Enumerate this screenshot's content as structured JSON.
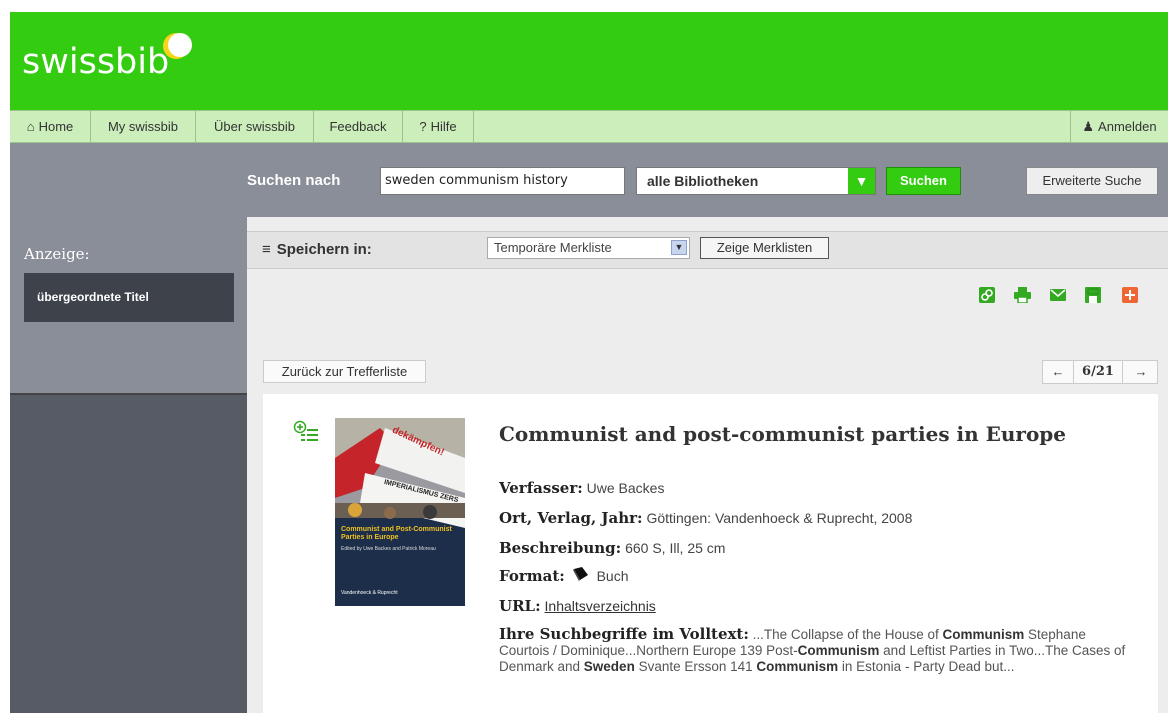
{
  "header": {
    "logo_text": "swissbib"
  },
  "nav": {
    "items": [
      {
        "label": "Home",
        "icon": "house-icon"
      },
      {
        "label": "My swissbib"
      },
      {
        "label": "Über swissbib"
      },
      {
        "label": "Feedback"
      },
      {
        "label": "Hilfe",
        "icon": "question-icon"
      }
    ],
    "login": {
      "label": "Anmelden",
      "icon": "user-icon"
    }
  },
  "search": {
    "label": "Suchen nach",
    "query": "sweden communism history",
    "library_select": "alle Bibliotheken",
    "submit_label": "Suchen",
    "advanced_label": "Erweiterte Suche"
  },
  "sidebar": {
    "heading": "Anzeige:",
    "button_label": "übergeordnete Titel"
  },
  "save": {
    "label": "Speichern in:",
    "list_select": "Temporäre Merkliste",
    "show_lists_label": "Zeige Merklisten"
  },
  "toolbar": {
    "icons": [
      "link-icon",
      "print-icon",
      "mail-icon",
      "save-icon",
      "add-icon"
    ],
    "colors": {
      "green": "#33aa22",
      "orange": "#ee6633"
    }
  },
  "navigation": {
    "back_label": "Zurück zur Trefferliste",
    "prev_icon": "←",
    "page": "6/21",
    "next_icon": "→"
  },
  "record": {
    "title": "Communist and post-communist parties in Europe",
    "cover": {
      "banner_text": "dekämpfen!",
      "banner_text2": "IMPERIALISMUS ZERS",
      "book_title": "Communist and Post-Communist Parties in Europe",
      "editors": "Edited by Uwe Backes and Patrick Moreau",
      "publisher": "Vandenhoeck & Ruprecht"
    },
    "author_label": "Verfasser:",
    "author": "Uwe Backes",
    "place_label": "Ort, Verlag, Jahr:",
    "place": "Göttingen: Vandenhoeck & Ruprecht, 2008",
    "desc_label": "Beschreibung:",
    "desc": "660 S, Ill, 25 cm",
    "format_label": "Format:",
    "format": "Buch",
    "url_label": "URL:",
    "url_text": "Inhaltsverzeichnis",
    "snippet_label": "Ihre Suchbegriffe im Volltext:",
    "snippet_parts": {
      "p1": " ...The Collapse of the House of ",
      "b1": "Communism",
      "p2": " Stephane Courtois / Dominique...Northern Europe 139 Post-",
      "b2": "Communism",
      "p3": " and Leftist Parties in Two...The Cases of Denmark and ",
      "b3": "Sweden",
      "p4": " Svante Ersson 141 ",
      "b4": "Communism",
      "p5": " in Estonia - Party Dead but..."
    }
  }
}
